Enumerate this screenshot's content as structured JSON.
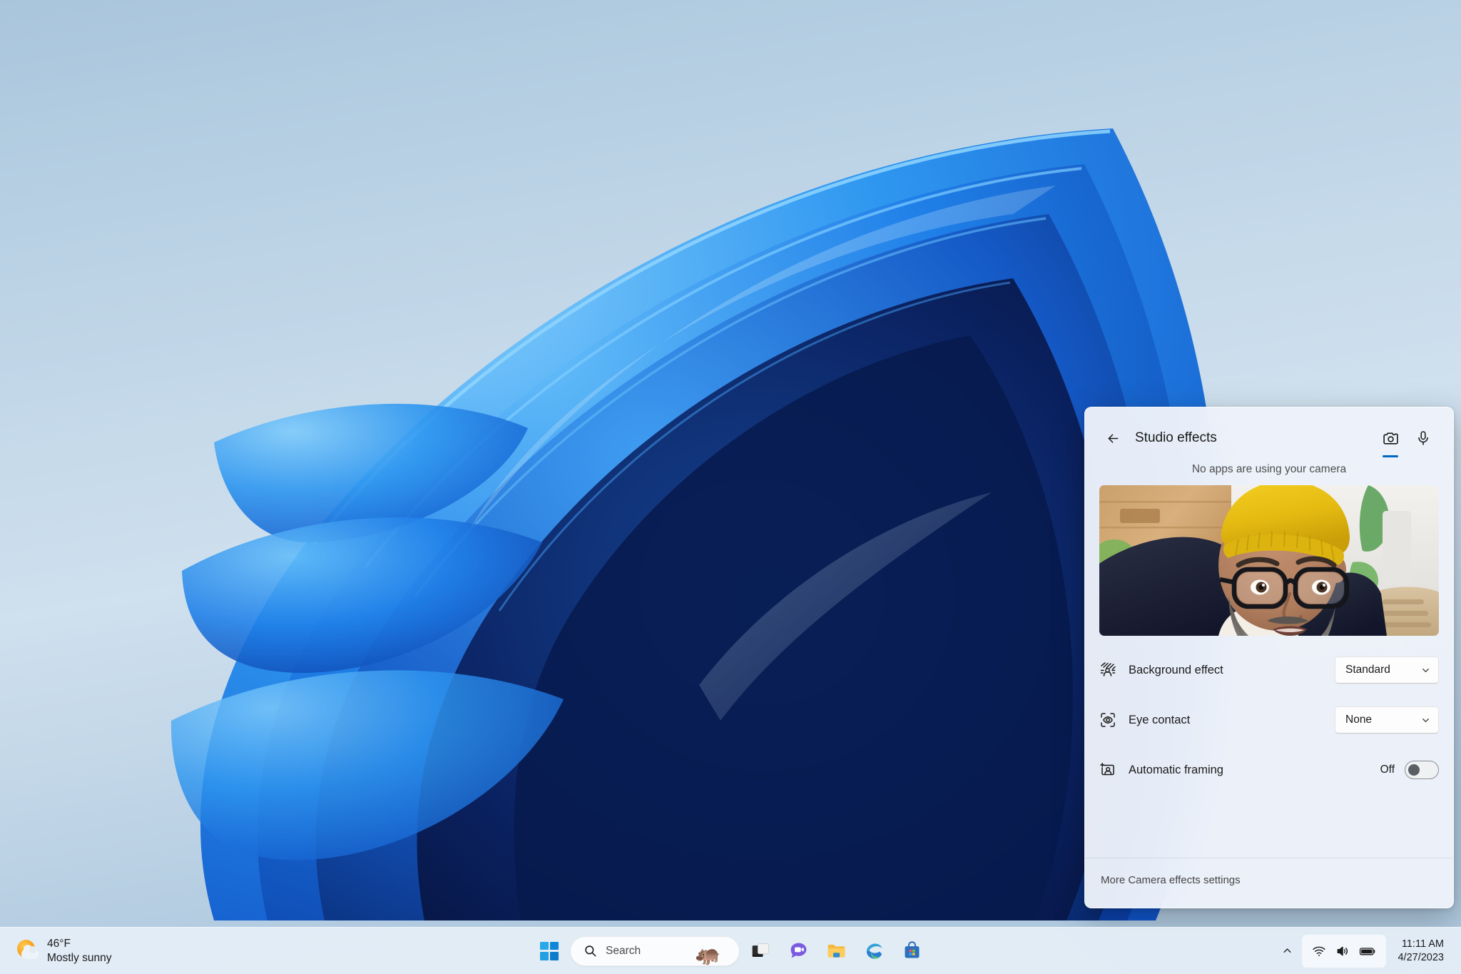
{
  "desktop": {
    "wallpaper_name": "windows-11-bloom-wallpaper",
    "colors": {
      "sky_top": "#aac6dd",
      "sky_mid": "#cfe0ee",
      "bloom_light": "#5eb8f7",
      "bloom_mid": "#1b7de8",
      "bloom_deep": "#0b3fa8",
      "bloom_core": "#071a4d"
    }
  },
  "taskbar": {
    "weather": {
      "icon": "sun-behind-cloud-icon",
      "temperature": "46°F",
      "condition": "Mostly sunny"
    },
    "start_button": {
      "name": "start-button",
      "icon": "windows-logo-icon"
    },
    "search": {
      "icon": "search-icon",
      "placeholder": "Search",
      "decoration_icon": "hippo-illustration",
      "decoration_glyph": "🦛"
    },
    "apps": [
      {
        "name": "task-view",
        "icon": "task-view-icon",
        "label": "Task View"
      },
      {
        "name": "chat",
        "icon": "chat-video-icon",
        "label": "Chat"
      },
      {
        "name": "file-explorer",
        "icon": "folder-icon",
        "label": "File Explorer"
      },
      {
        "name": "microsoft-edge",
        "icon": "edge-icon",
        "label": "Microsoft Edge"
      },
      {
        "name": "microsoft-store",
        "icon": "store-bag-icon",
        "label": "Microsoft Store"
      }
    ],
    "tray": {
      "overflow_icon": "chevron-up-icon",
      "network_icon": "wifi-icon",
      "volume_icon": "speaker-icon",
      "battery_icon": "battery-icon",
      "time": "11:11 AM",
      "date": "4/27/2023"
    }
  },
  "studio_effects": {
    "back_icon": "back-arrow-icon",
    "title": "Studio effects",
    "tabs": [
      {
        "name": "camera-tab",
        "icon": "camera-icon",
        "active": true
      },
      {
        "name": "microphone-tab",
        "icon": "microphone-icon",
        "active": false
      }
    ],
    "status_text": "No apps are using your camera",
    "preview": {
      "name": "camera-preview",
      "description": "Man wearing a yellow knit beanie and black glasses with a gray beard and navy hoodie, seated in front of a wood plank wall with green plants"
    },
    "settings": [
      {
        "icon": "background-effect-icon",
        "label": "Background effect",
        "control": "dropdown",
        "value": "Standard",
        "chevron": "chevron-down-icon"
      },
      {
        "icon": "eye-contact-icon",
        "label": "Eye contact",
        "control": "dropdown",
        "value": "None",
        "chevron": "chevron-down-icon"
      },
      {
        "icon": "automatic-framing-icon",
        "label": "Automatic framing",
        "control": "toggle",
        "value": "Off",
        "checked": false
      }
    ],
    "footer_link": "More Camera effects settings",
    "accent_color": "#0067C0"
  }
}
